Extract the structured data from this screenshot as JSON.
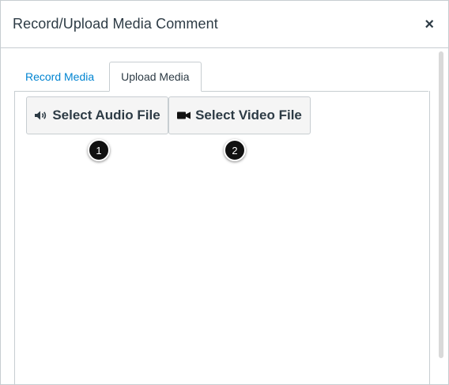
{
  "dialog": {
    "title": "Record/Upload Media Comment",
    "close_label": "×"
  },
  "tabs": [
    {
      "label": "Record Media",
      "active": false
    },
    {
      "label": "Upload Media",
      "active": true
    }
  ],
  "buttons": {
    "audio": {
      "label": "Select Audio File",
      "icon": "speaker-icon"
    },
    "video": {
      "label": "Select Video File",
      "icon": "video-camera-icon"
    }
  },
  "callouts": [
    "1",
    "2"
  ],
  "colors": {
    "link": "#0084d1",
    "text": "#2d3b45",
    "border": "#c7cdd1",
    "button_bg": "#f5f5f5",
    "badge_bg": "#111111"
  }
}
